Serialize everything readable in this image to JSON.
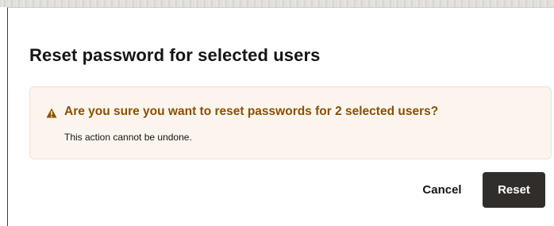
{
  "dialog": {
    "title": "Reset password for selected users",
    "warning": {
      "icon": "warning-triangle-icon",
      "message": "Are you sure you want to reset passwords for 2 selected users?",
      "detail": "This action cannot be undone."
    },
    "buttons": {
      "cancel_label": "Cancel",
      "reset_label": "Reset"
    }
  },
  "colors": {
    "title_text": "#161513",
    "warning_background": "#fcf5ee",
    "warning_border": "#f0e0d0",
    "warning_text": "#8b4f00",
    "primary_button": "#312d2a",
    "primary_button_text": "#ffffff"
  }
}
